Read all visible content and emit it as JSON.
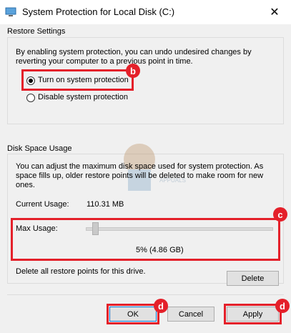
{
  "window": {
    "title": "System Protection for Local Disk (C:)",
    "close_glyph": "✕"
  },
  "restore": {
    "group_label": "Restore Settings",
    "description_line1": "By enabling system protection, you can undo undesired changes by",
    "description_line2": "reverting your computer to a previous point in time.",
    "option_on": "Turn on system protection",
    "option_off": "Disable system protection",
    "selected": "Turn on system protection"
  },
  "disk": {
    "group_label": "Disk Space Usage",
    "description_line1": "You can adjust the maximum disk space used for system protection. As",
    "description_line2": "space fills up, older restore points will be deleted to make room for new",
    "description_line3": "ones.",
    "current_usage_label": "Current Usage:",
    "current_usage_value": "110.31 MB",
    "max_usage_label": "Max Usage:",
    "max_usage_fraction": 0.05,
    "max_usage_value": "5% (4.86 GB)",
    "delete_text": "Delete all restore points for this drive.",
    "delete_button": "Delete"
  },
  "footer": {
    "ok": "OK",
    "cancel": "Cancel",
    "apply": "Apply"
  },
  "annotations": {
    "b": "b",
    "c": "c",
    "d1": "d",
    "d2": "d"
  },
  "colors": {
    "highlight": "#e4202a",
    "dialog_bg": "#f0f0f0",
    "button_bg": "#e1e1e1"
  }
}
